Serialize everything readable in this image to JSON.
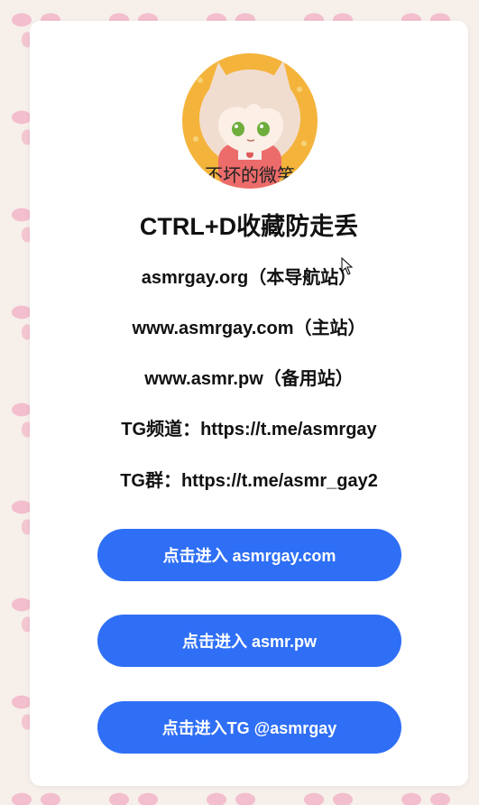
{
  "card": {
    "avatar_caption": "不坏的微笑",
    "title": "CTRL+D收藏防走丢",
    "lines": [
      "asmrgay.org（本导航站）",
      "www.asmrgay.com（主站）",
      "www.asmr.pw（备用站）",
      "TG频道：https://t.me/asmrgay",
      "TG群：https://t.me/asmr_gay2"
    ],
    "buttons": [
      "点击进入 asmrgay.com",
      "点击进入 asmr.pw",
      "点击进入TG @asmrgay"
    ]
  },
  "colors": {
    "accent": "#2f6ff5",
    "background": "#f6efea",
    "card": "#ffffff"
  }
}
